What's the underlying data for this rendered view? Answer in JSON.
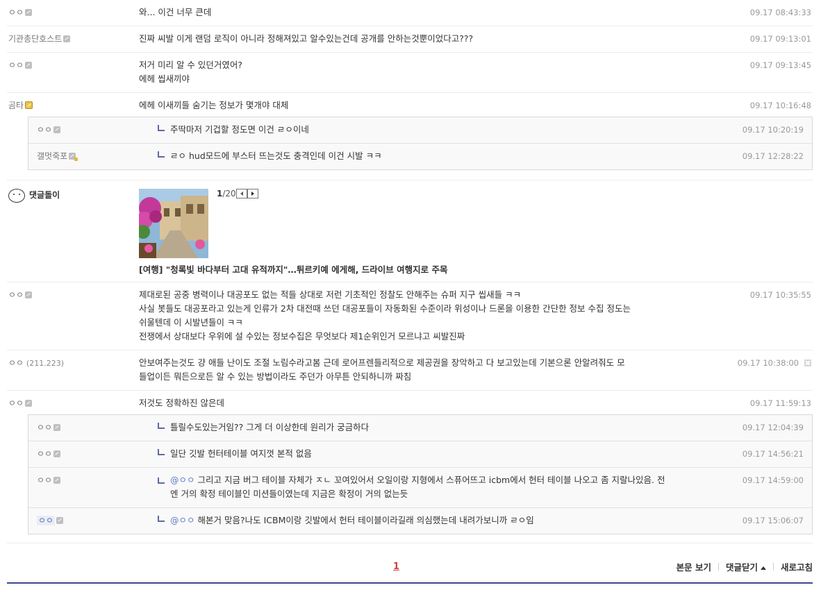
{
  "comments_top": [
    {
      "nick": "ㅇㅇ",
      "icon": "gallog-icon",
      "text": [
        "와... 이건 너무 큰데"
      ],
      "date": "09.17 08:43:33"
    },
    {
      "nick": "기관총단호스트",
      "icon": "gallog-icon",
      "text": [
        "진짜 씨발 이게 랜덤 로직이 아니라 정해져있고 알수있는건데 공개를 안하는것뿐이었다고???"
      ],
      "date": "09.17 09:13:01"
    },
    {
      "nick": "ㅇㅇ",
      "icon": "gallog-icon",
      "text": [
        "저거 미리 알 수 있던거였어?",
        "에헤 씹새끼야"
      ],
      "date": "09.17 09:13:45"
    },
    {
      "nick": "곰타",
      "icon": "gold-gallog-icon",
      "text": [
        "에헤 이새끼들 숨기는 정보가 몇개야 대체"
      ],
      "date": "09.17 10:16:48"
    }
  ],
  "replies_1": [
    {
      "nick": "ㅇㅇ",
      "text": "주딱마저 기겁할 정도면 이건 ㄹㅇ이네",
      "date": "09.17 10:20:19"
    },
    {
      "nick": "갤멋죽포",
      "text": "ㄹㅇ hud모드에 부스터 뜨는것도 충격인데 이건 시발 ㅋㅋ",
      "date": "09.17 12:28:22"
    }
  ],
  "bot": {
    "nick": "댓글돌이",
    "page_current": "1",
    "page_total": "/20",
    "headline": "[여행] \"청록빛 바다부터 고대 유적까지\"…튀르키예 에게해, 드라이브 여행지로 주목"
  },
  "comments_mid": [
    {
      "nick": "ㅇㅇ",
      "ip": "",
      "text": [
        "제대로된 공중 병력이나 대공포도 없는 적들 상대로 저런 기초적인 정찰도 안해주는 슈퍼 지구 씹새들 ㅋㅋ",
        "사실 봇들도 대공포라고 있는게 인류가 2차 대전때 쓰던 대공포들이 자동화된 수준이라 위성이나 드론을 이용한 간단한 정보 수집 정도는",
        "쉬울텐데 이 시발년들이 ㅋㅋ",
        "전쟁에서 상대보다 우위에 설 수있는 정보수집은 무엇보다 제1순위인거 모르냐고 씨발진짜"
      ],
      "date": "09.17 10:35:55"
    },
    {
      "nick": "ㅇㅇ",
      "ip": "(211.223)",
      "text": [
        "안보여주는것도 걍 애들 난이도 조절 노림수라고봄 근데 로어프렌들리적으로 제공권을 장악하고 다 보고있는데 기본으론 안알려줘도 모",
        "들업이든 뭐든으로든 알 수 있는 방법이라도 주던가 아무튼 안되하니까 짜침"
      ],
      "date": "09.17 10:38:00"
    },
    {
      "nick": "ㅇㅇ",
      "ip": "",
      "text": [
        "저것도 정확하진 않은데"
      ],
      "date": "09.17 11:59:13"
    }
  ],
  "replies_2": [
    {
      "nick": "ㅇㅇ",
      "mention": "",
      "text": [
        "틀릴수도있는거임?? 그게 더 이상한데 원리가 궁금하다"
      ],
      "date": "09.17 12:04:39"
    },
    {
      "nick": "ㅇㅇ",
      "mention": "",
      "text": [
        "일단 깃발 헌터테이블 여지껏 본적 없음"
      ],
      "date": "09.17 14:56:21"
    },
    {
      "nick": "ㅇㅇ",
      "mention": "@ㅇㅇ",
      "text": [
        "그리고 지금 버그 테이블 자체가 ㅈㄴ 꼬여있어서 오일이랑 지형에서 스퓨어뜨고 icbm에서 헌터 테이블 나오고 좀 지랄나있음. 전",
        "엔 거의 확정 테이블인 미션들이였는데 지금은 확정이 거의 없는듯"
      ],
      "date": "09.17 14:59:00"
    },
    {
      "nick": "ㅇㅇ",
      "mention": "@ㅇㅇ",
      "text": [
        "해본거 맞음?나도 ICBM이랑 깃발에서 헌터 테이블이라길래 의심했는데 내려가보니까 ㄹㅇ임"
      ],
      "date": "09.17 15:06:07"
    }
  ],
  "footer": {
    "page": "1",
    "view_post": "본문 보기",
    "close_comments": "댓글닫기",
    "refresh": "새로고침"
  }
}
